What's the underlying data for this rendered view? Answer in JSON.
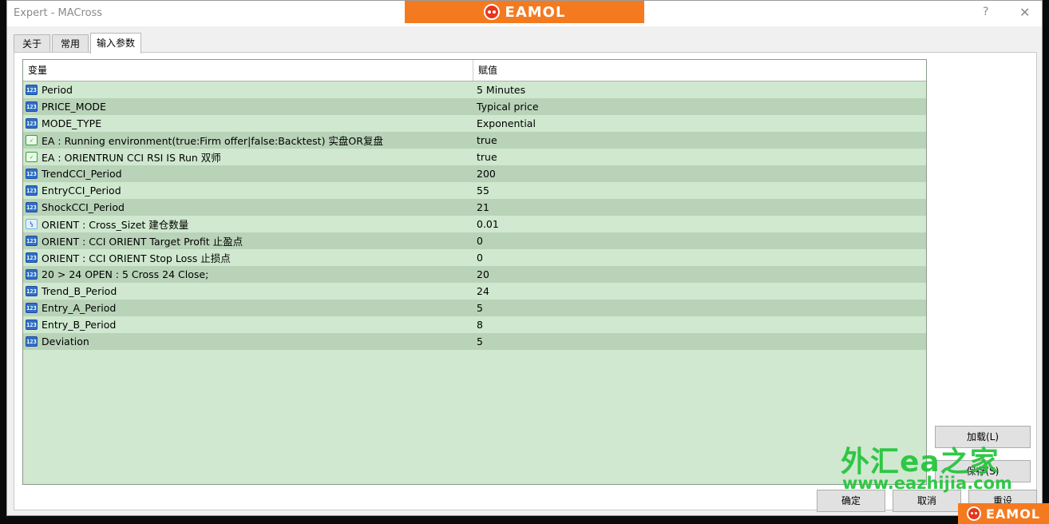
{
  "window": {
    "title": "Expert - MACross",
    "brand": "EAMOL",
    "help_label": "?",
    "close_label": "✕"
  },
  "tabs": [
    {
      "label": "关于"
    },
    {
      "label": "常用"
    },
    {
      "label": "输入参数"
    }
  ],
  "grid": {
    "columns": {
      "variable": "变量",
      "value": "赋值"
    },
    "rows": [
      {
        "icon": "int",
        "name": "Period",
        "value": "5 Minutes"
      },
      {
        "icon": "int",
        "name": "PRICE_MODE",
        "value": "Typical price"
      },
      {
        "icon": "int",
        "name": "MODE_TYPE",
        "value": "Exponential"
      },
      {
        "icon": "bool",
        "name": "EA : Running environment(true:Firm offer|false:Backtest) 实盘OR复盘",
        "value": "true"
      },
      {
        "icon": "bool",
        "name": "EA : ORIENTRUN  CCI RSI IS Run 双师",
        "value": "true"
      },
      {
        "icon": "int",
        "name": "TrendCCI_Period",
        "value": "200"
      },
      {
        "icon": "int",
        "name": "EntryCCI_Period",
        "value": "55"
      },
      {
        "icon": "int",
        "name": "ShockCCI_Period",
        "value": "21"
      },
      {
        "icon": "dbl",
        "name": "ORIENT : Cross_Sizet  建仓数量",
        "value": "0.01"
      },
      {
        "icon": "int",
        "name": "ORIENT : CCI ORIENT Target Profit 止盈点",
        "value": "0"
      },
      {
        "icon": "int",
        "name": "ORIENT : CCI ORIENT Stop Loss 止损点",
        "value": "0"
      },
      {
        "icon": "int",
        "name": "20 > 24 OPEN  :   5 Cross 24 Close;",
        "value": "20"
      },
      {
        "icon": "int",
        "name": "Trend_B_Period",
        "value": "24"
      },
      {
        "icon": "int",
        "name": "Entry_A_Period",
        "value": "5"
      },
      {
        "icon": "int",
        "name": "Entry_B_Period",
        "value": "8"
      },
      {
        "icon": "int",
        "name": "Deviation",
        "value": "5"
      }
    ]
  },
  "icon_glyphs": {
    "int": "123",
    "bool": "✓",
    "dbl": "½"
  },
  "buttons": {
    "load": "加载(L)",
    "save": "保存(S)",
    "ok": "确定",
    "cancel": "取消",
    "reset": "重设"
  },
  "watermark": {
    "cn": "外汇ea之家",
    "url": "www.eazhijia.com"
  },
  "colors": {
    "brand_orange": "#f47a20",
    "grid_row": "#cfe8cf",
    "grid_row_alt": "#b9d3b9",
    "watermark_green": "#22c43a"
  }
}
